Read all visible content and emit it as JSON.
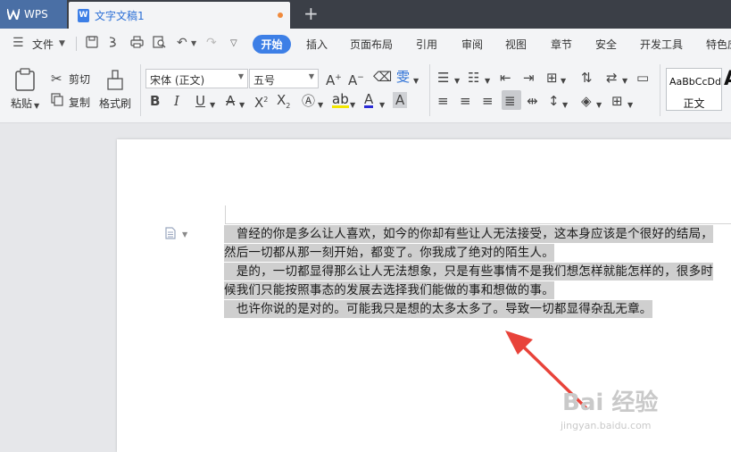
{
  "titlebar": {
    "app_tab": "WPS",
    "doc_tab": "文字文稿1",
    "doc_badge": "W",
    "new_tab": "+"
  },
  "menubar": {
    "file": "文件",
    "items": [
      "开始",
      "插入",
      "页面布局",
      "引用",
      "审阅",
      "视图",
      "章节",
      "安全",
      "开发工具",
      "特色应"
    ]
  },
  "toolbar": {
    "paste": "粘贴",
    "cut": "剪切",
    "copy": "复制",
    "format_painter": "格式刷",
    "font_name": "宋体 (正文)",
    "font_size": "五号",
    "style_sample": "AaBbCcDd",
    "style_name": "正文",
    "style_next": "A"
  },
  "document": {
    "lines": [
      "　曾经的你是多么让人喜欢，如今的你却有些让人无法接受，这本身应该是个很好的结局，",
      "然后一切都从那一刻开始，都变了。你我成了绝对的陌生人。",
      "　是的，一切都显得那么让人无法想象，只是有些事情不是我们想怎样就能怎样的，很多时",
      "候我们只能按照事态的发展去选择我们能做的事和想做的事。",
      "　也许你说的是对的。可能我只是想的太多太多了。导致一切都显得杂乱无章。"
    ]
  },
  "watermark": {
    "brand": "Bai  经验",
    "url": "jingyan.baidu.com"
  },
  "colors": {
    "accent": "#3d7fe6",
    "selection": "#cfcfcf",
    "arrow": "#e8433a"
  }
}
